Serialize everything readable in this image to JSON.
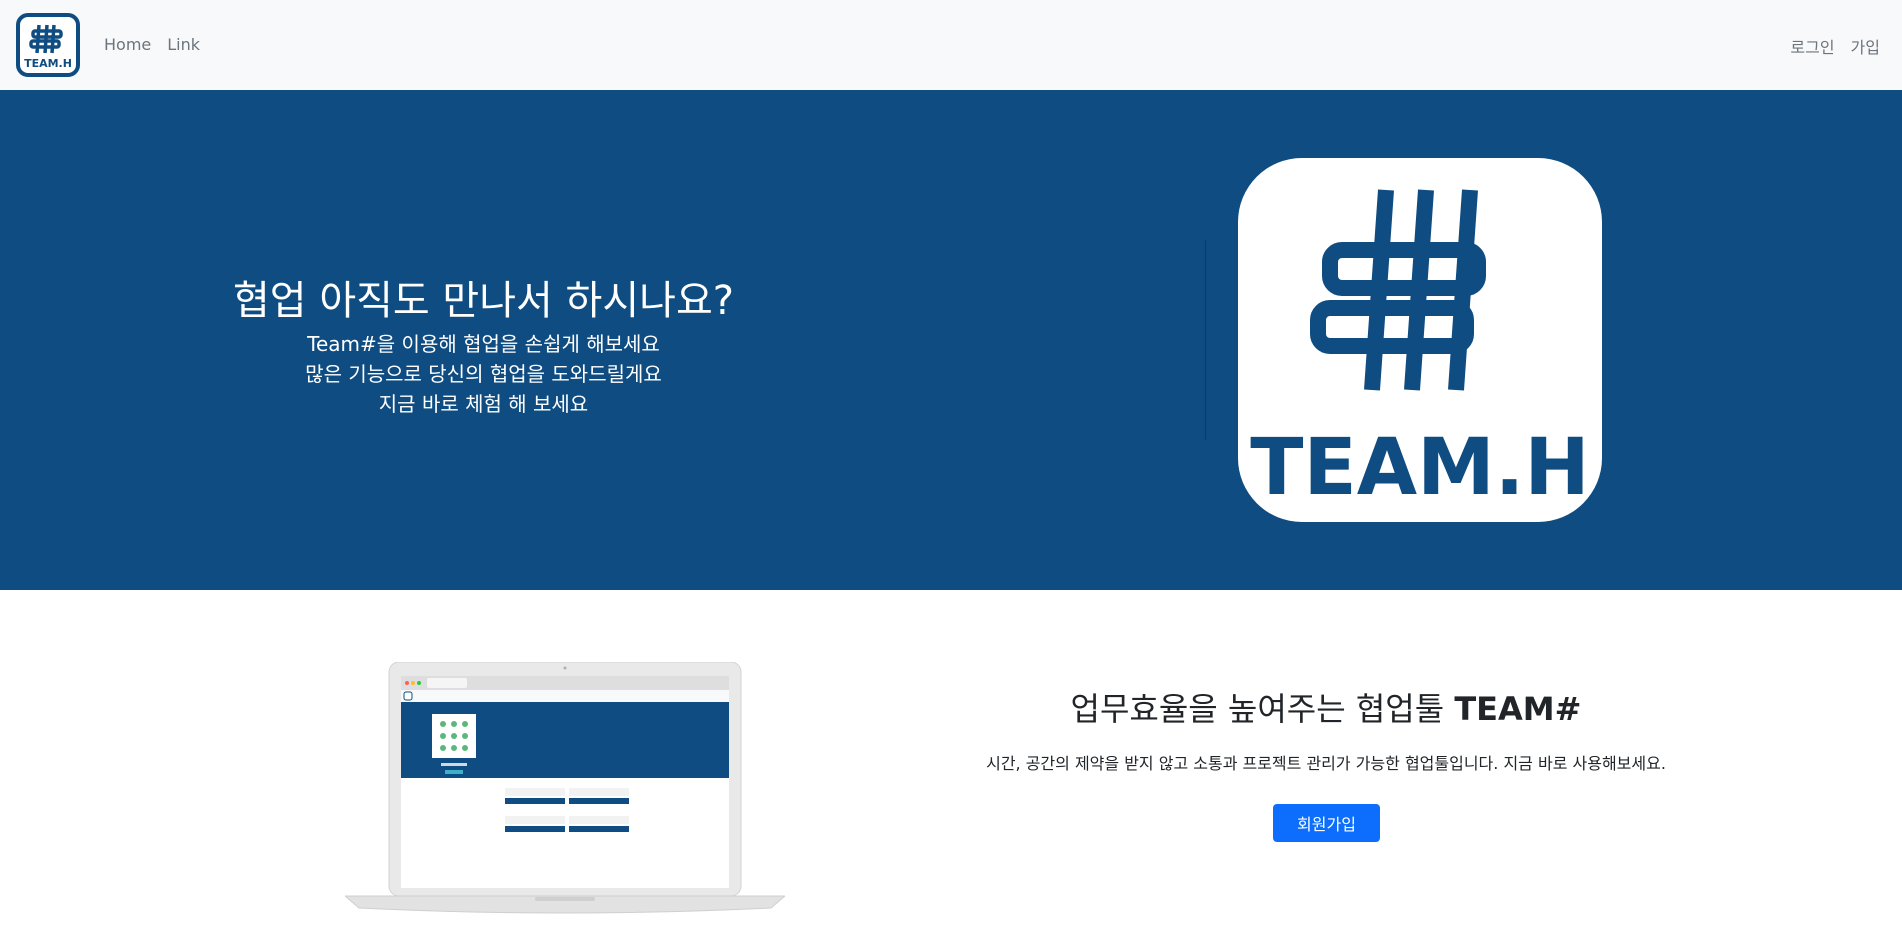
{
  "navbar": {
    "logo_text": "TEAM.H",
    "links": [
      {
        "label": "Home"
      },
      {
        "label": "Link"
      }
    ],
    "right_links": [
      {
        "label": "로그인"
      },
      {
        "label": "가입"
      }
    ]
  },
  "hero": {
    "title": "협업 아직도 만나서 하시나요?",
    "lines": [
      "Team#을 이용해 협업을 손쉽게 해보세요",
      "많은 기능으로 당신의 협업을 도와드릴게요",
      "지금 바로 체험 해 보세요"
    ],
    "logo_text": "TEAM.H"
  },
  "features": {
    "title_prefix": "업무효율을 높여주는 협업툴 ",
    "title_brand": "TEAM#",
    "description": "시간, 공간의 제약을 받지 않고 소통과 프로젝트 관리가 가능한 협업툴입니다. 지금 바로 사용해보세요.",
    "signup_label": "회원가입"
  },
  "colors": {
    "brand_blue": "#0f4c81",
    "button_blue": "#0d6efd",
    "navbar_bg": "#f8f9fa",
    "text_muted": "#6c757d"
  }
}
